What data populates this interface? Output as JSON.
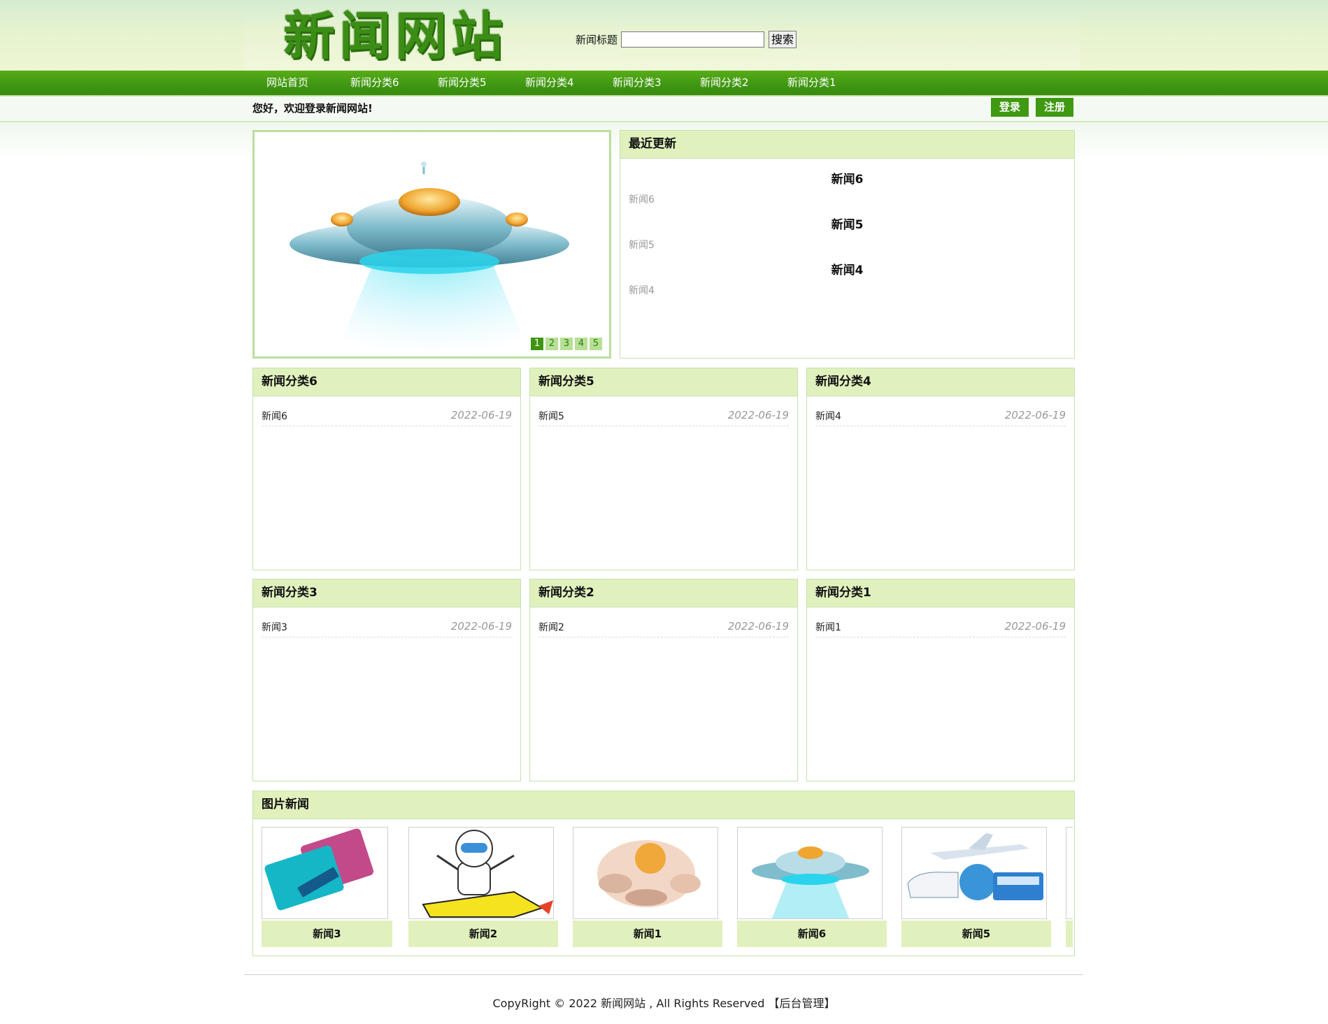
{
  "site": {
    "logo": "新闻网站"
  },
  "search": {
    "label": "新闻标题",
    "value": "",
    "button": "搜索"
  },
  "nav": [
    "网站首页",
    "新闻分类6",
    "新闻分类5",
    "新闻分类4",
    "新闻分类3",
    "新闻分类2",
    "新闻分类1"
  ],
  "welcome": "您好，欢迎登录新闻网站!",
  "auth": {
    "login": "登录",
    "register": "注册"
  },
  "slideshow": {
    "pages": [
      "1",
      "2",
      "3",
      "4",
      "5"
    ],
    "active_page": "1",
    "image": "ufo"
  },
  "recent": {
    "title": "最近更新",
    "items": [
      {
        "title": "新闻6",
        "summary": "新闻6"
      },
      {
        "title": "新闻5",
        "summary": "新闻5"
      },
      {
        "title": "新闻4",
        "summary": "新闻4"
      }
    ]
  },
  "categories": [
    {
      "title": "新闻分类6",
      "items": [
        {
          "name": "新闻6",
          "date": "2022-06-19"
        }
      ]
    },
    {
      "title": "新闻分类5",
      "items": [
        {
          "name": "新闻5",
          "date": "2022-06-19"
        }
      ]
    },
    {
      "title": "新闻分类4",
      "items": [
        {
          "name": "新闻4",
          "date": "2022-06-19"
        }
      ]
    },
    {
      "title": "新闻分类3",
      "items": [
        {
          "name": "新闻3",
          "date": "2022-06-19"
        }
      ]
    },
    {
      "title": "新闻分类2",
      "items": [
        {
          "name": "新闻2",
          "date": "2022-06-19"
        }
      ]
    },
    {
      "title": "新闻分类1",
      "items": [
        {
          "name": "新闻1",
          "date": "2022-06-19"
        }
      ]
    }
  ],
  "picture_news": {
    "title": "图片新闻",
    "items": [
      {
        "caption": "新闻3",
        "image": "space-tickets"
      },
      {
        "caption": "新闻2",
        "image": "robot-on-rocket"
      },
      {
        "caption": "新闻1",
        "image": "astronaut"
      },
      {
        "caption": "新闻6",
        "image": "ufo"
      },
      {
        "caption": "新闻5",
        "image": "plane-train-bus"
      }
    ]
  },
  "footer": {
    "copyright": "CopyRight © 2022 新闻网站 , All Rights Reserved",
    "admin_link": "【后台管理】"
  },
  "colors": {
    "brand_green": "#3f9512",
    "panel_head": "#e0f1bd",
    "border": "#c6e1b0"
  }
}
